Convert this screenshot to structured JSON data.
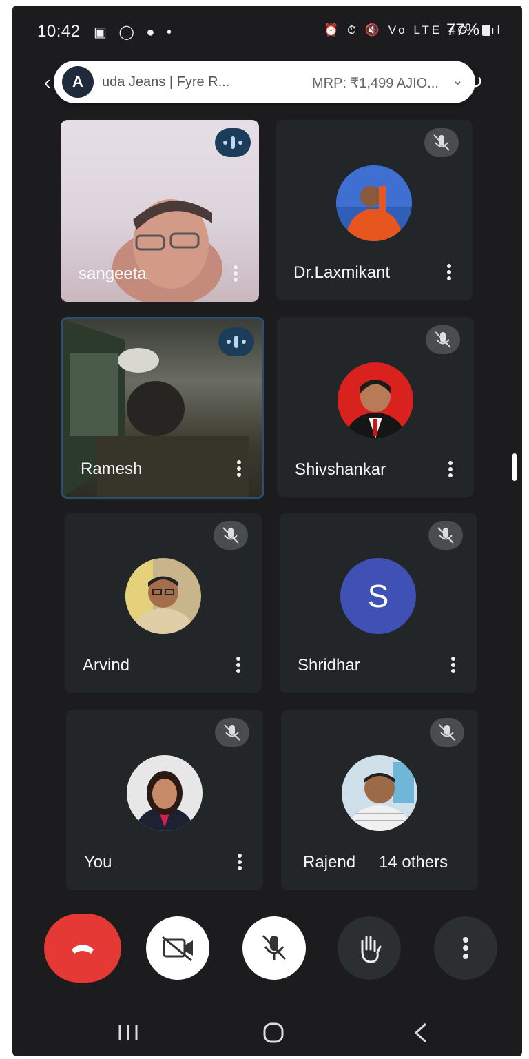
{
  "status_bar": {
    "time": "10:42",
    "battery": "77%"
  },
  "browser": {
    "page_title": "uda Jeans | Fyre R...",
    "price_text": "MRP: ₹1,499   AJIO..."
  },
  "participants": [
    {
      "name": "sangeeta",
      "state": "speaking",
      "type": "video"
    },
    {
      "name": "Dr.Laxmikant",
      "state": "muted",
      "type": "photo"
    },
    {
      "name": "Ramesh",
      "state": "speaking",
      "type": "video"
    },
    {
      "name": "Shivshankar",
      "state": "muted",
      "type": "photo"
    },
    {
      "name": "Arvind",
      "state": "muted",
      "type": "photo"
    },
    {
      "name": "Shridhar",
      "state": "muted",
      "type": "initial",
      "initial": "S"
    },
    {
      "name": "You",
      "state": "muted",
      "type": "photo"
    },
    {
      "name": "Rajend",
      "state": "muted",
      "type": "photo",
      "extra": "14 others"
    }
  ],
  "colors": {
    "end_call": "#e53935",
    "avatar_s": "#3f51b5",
    "speaking_indicator": "#1c3d5a"
  },
  "controls": {
    "icons": [
      "end-call-icon",
      "camera-off-icon",
      "mic-off-icon",
      "raise-hand-icon",
      "more-vert-icon"
    ]
  }
}
